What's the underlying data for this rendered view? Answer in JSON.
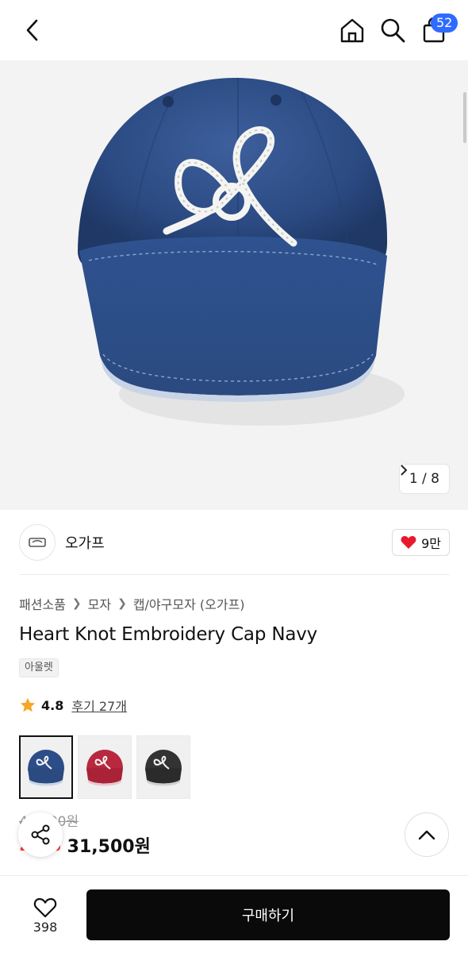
{
  "header": {
    "cart_count": "52",
    "icons": [
      "back-icon",
      "home-icon",
      "search-icon",
      "bag-icon"
    ]
  },
  "gallery": {
    "counter": "1 / 8"
  },
  "brand": {
    "name": "오가프",
    "like_count": "9만"
  },
  "breadcrumb": [
    "패션소품",
    "모자",
    "캡/야구모자 (오가프)"
  ],
  "product": {
    "title": "Heart Knot Embroidery Cap Navy",
    "tag": "아울렛",
    "rating": "4.8",
    "reviews": "후기 27개",
    "original_price": "41,000원",
    "discount": "23%",
    "price": "31,500원",
    "color_options": [
      "navy",
      "red",
      "black"
    ]
  },
  "bottom": {
    "wish_count": "398",
    "buy_label": "구매하기"
  },
  "colors": {
    "badge": "#2f6bff",
    "discount": "#ff3b30",
    "heart": "#e8192c",
    "buy_button": "#0a0a0a",
    "star": "#f5a623"
  }
}
